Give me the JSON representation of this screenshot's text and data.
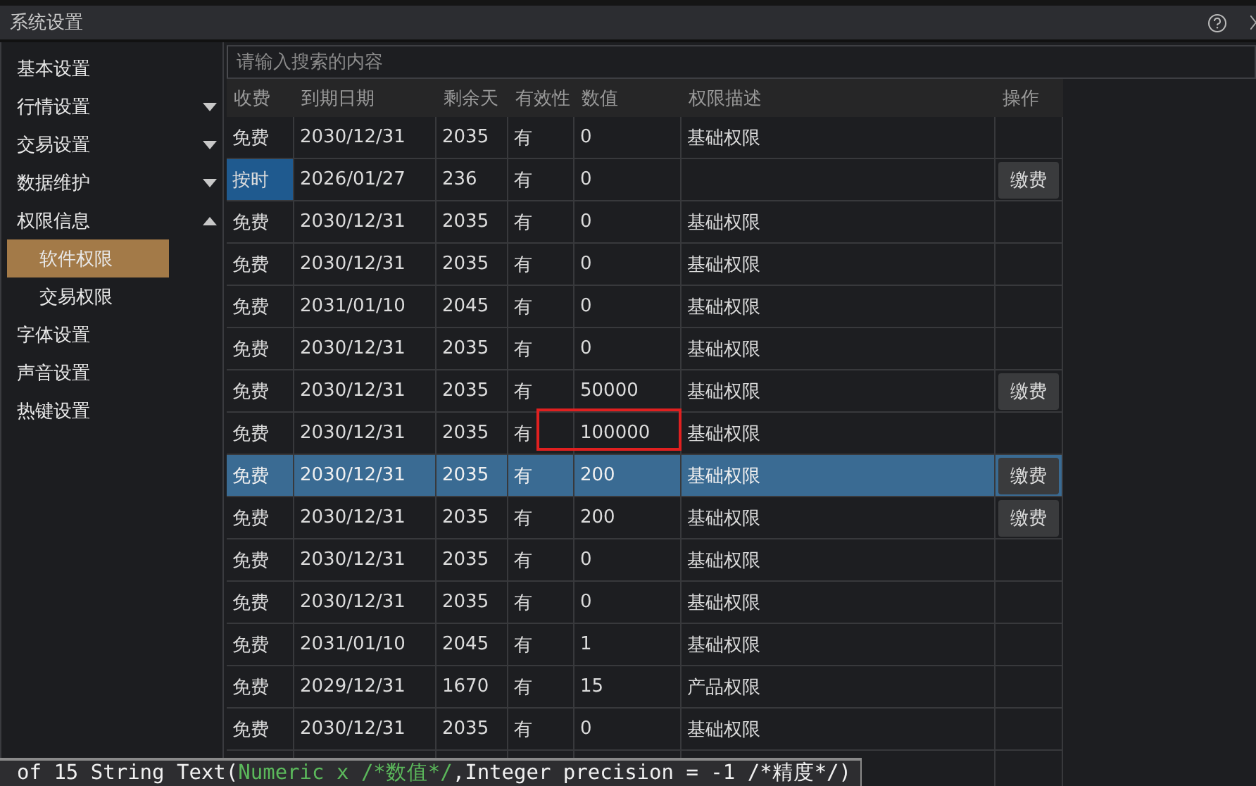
{
  "window": {
    "title": "系统设置"
  },
  "sidebar": {
    "items": [
      {
        "label": "基本设置",
        "kind": "item"
      },
      {
        "label": "行情设置",
        "kind": "group",
        "expanded": false
      },
      {
        "label": "交易设置",
        "kind": "group",
        "expanded": false
      },
      {
        "label": "数据维护",
        "kind": "group",
        "expanded": false
      },
      {
        "label": "权限信息",
        "kind": "group",
        "expanded": true,
        "children": [
          {
            "label": "软件权限",
            "selected": true
          },
          {
            "label": "交易权限",
            "selected": false
          }
        ]
      },
      {
        "label": "字体设置",
        "kind": "item"
      },
      {
        "label": "声音设置",
        "kind": "item"
      },
      {
        "label": "热键设置",
        "kind": "item"
      }
    ]
  },
  "search": {
    "placeholder": "请输入搜索的内容"
  },
  "table": {
    "columns": [
      "收费",
      "到期日期",
      "剩余天",
      "有效性",
      "数值",
      "权限描述",
      "操作"
    ],
    "rows": [
      {
        "cells": [
          "免费",
          "2030/12/31",
          "2035",
          "有",
          "0",
          "基础权限"
        ],
        "selected": false,
        "charge_focused": false,
        "marked": false
      },
      {
        "cells": [
          "按时",
          "2026/01/27",
          "236",
          "有",
          "0",
          ""
        ],
        "action": "缴费",
        "selected": false,
        "charge_focused": true,
        "marked": false
      },
      {
        "cells": [
          "免费",
          "2030/12/31",
          "2035",
          "有",
          "0",
          "基础权限"
        ],
        "selected": false,
        "charge_focused": false,
        "marked": false
      },
      {
        "cells": [
          "免费",
          "2030/12/31",
          "2035",
          "有",
          "0",
          "基础权限"
        ],
        "selected": false,
        "charge_focused": false,
        "marked": false
      },
      {
        "cells": [
          "免费",
          "2031/01/10",
          "2045",
          "有",
          "0",
          "基础权限"
        ],
        "selected": false,
        "charge_focused": false,
        "marked": false
      },
      {
        "cells": [
          "免费",
          "2030/12/31",
          "2035",
          "有",
          "0",
          "基础权限"
        ],
        "selected": false,
        "charge_focused": false,
        "marked": false
      },
      {
        "cells": [
          "免费",
          "2030/12/31",
          "2035",
          "有",
          "50000",
          "基础权限"
        ],
        "action": "缴费",
        "selected": false,
        "charge_focused": false,
        "marked": false
      },
      {
        "cells": [
          "免费",
          "2030/12/31",
          "2035",
          "有",
          "100000",
          "基础权限"
        ],
        "selected": false,
        "charge_focused": false,
        "marked": true
      },
      {
        "cells": [
          "免费",
          "2030/12/31",
          "2035",
          "有",
          "200",
          "基础权限"
        ],
        "action": "缴费",
        "selected": true,
        "charge_focused": false,
        "marked": false
      },
      {
        "cells": [
          "免费",
          "2030/12/31",
          "2035",
          "有",
          "200",
          "基础权限"
        ],
        "action": "缴费",
        "selected": false,
        "charge_focused": false,
        "marked": false
      },
      {
        "cells": [
          "免费",
          "2030/12/31",
          "2035",
          "有",
          "0",
          "基础权限"
        ],
        "selected": false,
        "charge_focused": false,
        "marked": false
      },
      {
        "cells": [
          "免费",
          "2030/12/31",
          "2035",
          "有",
          "0",
          "基础权限"
        ],
        "selected": false,
        "charge_focused": false,
        "marked": false
      },
      {
        "cells": [
          "免费",
          "2031/01/10",
          "2045",
          "有",
          "1",
          "基础权限"
        ],
        "selected": false,
        "charge_focused": false,
        "marked": false
      },
      {
        "cells": [
          "免费",
          "2029/12/31",
          "1670",
          "有",
          "15",
          "产品权限"
        ],
        "selected": false,
        "charge_focused": false,
        "marked": false
      },
      {
        "cells": [
          "免费",
          "2030/12/31",
          "2035",
          "有",
          "0",
          "基础权限"
        ],
        "selected": false,
        "charge_focused": false,
        "marked": false
      }
    ]
  },
  "tooltip": {
    "before": "of 15 String Text(",
    "highlight": "Numeric x /*数值*/",
    "after": ",Integer precision = -1 /*精度*/)"
  }
}
